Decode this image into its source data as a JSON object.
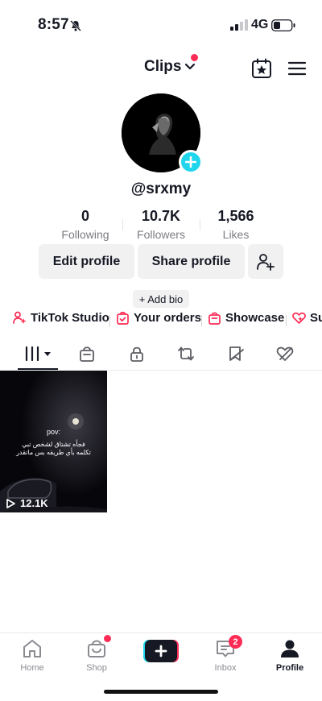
{
  "status": {
    "time": "8:57",
    "network": "4G"
  },
  "header": {
    "account_name": "Clips"
  },
  "profile": {
    "username": "@srxmy",
    "add_bio": "+ Add bio"
  },
  "stats": [
    {
      "value": "0",
      "label": "Following"
    },
    {
      "value": "10.7K",
      "label": "Followers"
    },
    {
      "value": "1,566",
      "label": "Likes"
    }
  ],
  "actions": {
    "edit_profile": "Edit profile",
    "share_profile": "Share profile"
  },
  "links": [
    {
      "label": "TikTok Studio",
      "icon": "studio-icon"
    },
    {
      "label": "Your orders",
      "icon": "orders-icon"
    },
    {
      "label": "Showcase",
      "icon": "showcase-icon"
    },
    {
      "label": "Su",
      "icon": "subscription-icon"
    }
  ],
  "tabs": [
    "videos",
    "shop",
    "private",
    "reposts",
    "favorites",
    "liked"
  ],
  "videos": [
    {
      "views": "12.1K",
      "overlay_title": "pov:",
      "overlay_line1": "فجأه تشتاق لشخص تبي",
      "overlay_line2": "تكلمه بأي طريقه بس ماتقدر"
    }
  ],
  "nav": {
    "home": "Home",
    "shop": "Shop",
    "inbox": "Inbox",
    "inbox_badge": "2",
    "profile": "Profile"
  },
  "colors": {
    "accent": "#fe2c55",
    "cyan": "#20d5ec",
    "text": "#161823",
    "muted": "#7b7c82"
  }
}
